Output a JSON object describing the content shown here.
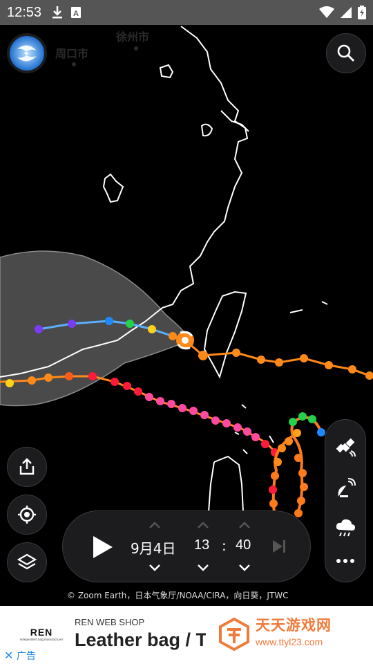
{
  "status_bar": {
    "time": "12:53",
    "left_icons": [
      "download-icon",
      "font-a-icon"
    ],
    "right_icons": [
      "wifi-icon",
      "signal-icon",
      "battery-charging-icon"
    ]
  },
  "map": {
    "city_labels": [
      "徐州市",
      "周口市"
    ],
    "storm_icon": "typhoon-icon"
  },
  "controls": {
    "search_icon": "search-icon",
    "share_icon": "share-icon",
    "locate_icon": "locate-icon",
    "layers_icon": "layers-icon",
    "layer_panel": [
      "satellite-icon",
      "radar-icon",
      "rain-icon",
      "more-icon"
    ]
  },
  "timeline": {
    "date": "9月4日",
    "hour": "13",
    "separator": ":",
    "minute": "40"
  },
  "attribution": "© Zoom Earth，日本气象厅/NOAA/CIRA，向日葵，JTWC",
  "ad": {
    "brand": "REN",
    "brand_sub": "independent bag manufacturer",
    "shop": "REN WEB SHOP",
    "headline": "Leather bag / T",
    "close_label": "✕",
    "ad_tag": "广告",
    "watermark_title": "天天游戏网",
    "watermark_url": "www.ttyl23.com"
  }
}
